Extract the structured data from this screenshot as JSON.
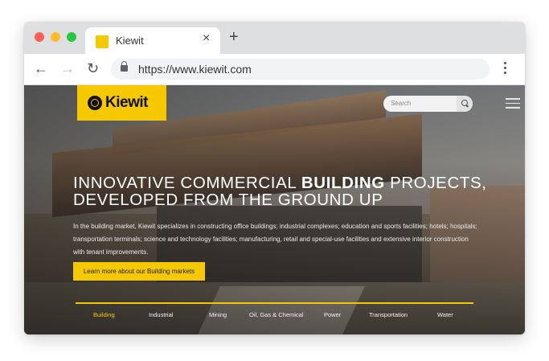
{
  "browser": {
    "tab_title": "Kiewit",
    "tab_close": "×",
    "new_tab": "+",
    "url": "https://www.kiewit.com",
    "back": "←",
    "forward": "→",
    "reload": "↻"
  },
  "site": {
    "logo_text": "Kiewit",
    "search_placeholder": "Search",
    "hero": {
      "headline_part1": "INNOVATIVE COMMERCIAL ",
      "headline_bold": "BUILDING",
      "headline_part2": " PROJECTS,",
      "headline_line2": "DEVELOPED FROM THE GROUND UP",
      "description": "In the building market, Kiewit specializes in constructing office buildings; industrial complexes; education and sports facilities; hotels; hospitals; transportation terminals; science and technology facilities; manufacturing, retail and special-use facilities and extensive interior construction with tenant improvements.",
      "cta_label": "Learn more about our Building markets"
    },
    "markets_nav": [
      "Building",
      "Industrial",
      "Mining",
      "Oil, Gas & Chemical",
      "Power",
      "Transportation",
      "Water"
    ]
  },
  "colors": {
    "accent": "#f5c800"
  }
}
